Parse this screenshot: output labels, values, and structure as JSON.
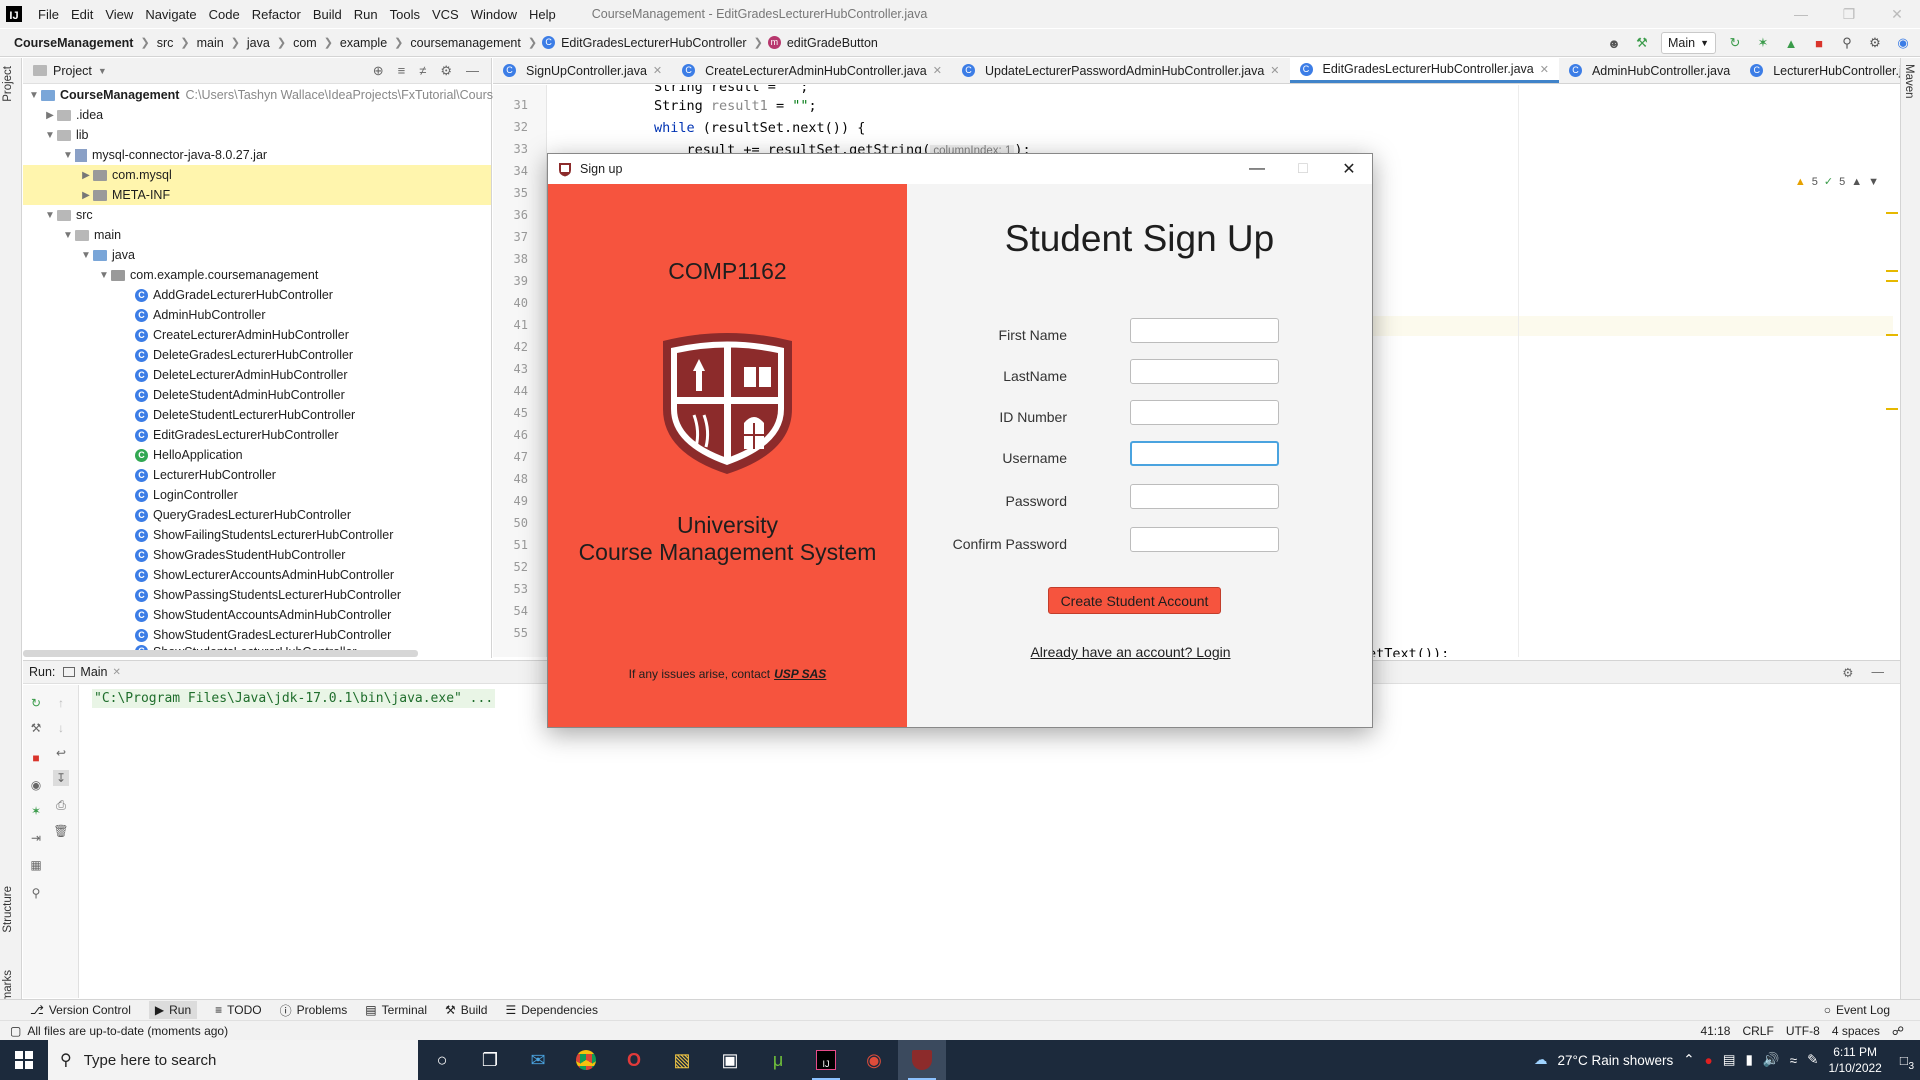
{
  "ide": {
    "window_title": "CourseManagement - EditGradesLecturerHubController.java",
    "menu": [
      "File",
      "Edit",
      "View",
      "Navigate",
      "Code",
      "Refactor",
      "Build",
      "Run",
      "Tools",
      "VCS",
      "Window",
      "Help"
    ],
    "breadcrumbs": [
      "CourseManagement",
      "src",
      "main",
      "java",
      "com",
      "example",
      "coursemanagement",
      "EditGradesLecturerHubController",
      "editGradeButton"
    ],
    "run_config": "Main"
  },
  "project": {
    "header": "Project",
    "tree": [
      {
        "label": "CourseManagement",
        "path": "C:\\Users\\Tashyn Wallace\\IdeaProjects\\FxTutorial\\CourseMa"
      },
      {
        "label": ".idea"
      },
      {
        "label": "lib"
      },
      {
        "label": "mysql-connector-java-8.0.27.jar"
      },
      {
        "label": "com.mysql"
      },
      {
        "label": "META-INF"
      },
      {
        "label": "src"
      },
      {
        "label": "main"
      },
      {
        "label": "java"
      },
      {
        "label": "com.example.coursemanagement"
      },
      {
        "label": "AddGradeLecturerHubController"
      },
      {
        "label": "AdminHubController"
      },
      {
        "label": "CreateLecturerAdminHubController"
      },
      {
        "label": "DeleteGradesLecturerHubController"
      },
      {
        "label": "DeleteLecturerAdminHubController"
      },
      {
        "label": "DeleteStudentAdminHubController"
      },
      {
        "label": "DeleteStudentLecturerHubController"
      },
      {
        "label": "EditGradesLecturerHubController"
      },
      {
        "label": "HelloApplication"
      },
      {
        "label": "LecturerHubController"
      },
      {
        "label": "LoginController"
      },
      {
        "label": "QueryGradesLecturerHubController"
      },
      {
        "label": "ShowFailingStudentsLecturerHubController"
      },
      {
        "label": "ShowGradesStudentHubController"
      },
      {
        "label": "ShowLecturerAccountsAdminHubController"
      },
      {
        "label": "ShowPassingStudentsLecturerHubController"
      },
      {
        "label": "ShowStudentAccountsAdminHubController"
      },
      {
        "label": "ShowStudentGradesLecturerHubController"
      },
      {
        "label": "ShowStudentsLecturerHubController"
      }
    ]
  },
  "editor": {
    "tabs": [
      "SignUpController.java",
      "CreateLecturerAdminHubController.java",
      "UpdateLecturerPasswordAdminHubController.java",
      "EditGradesLecturerHubController.java",
      "AdminHubController.java",
      "LecturerHubController.java"
    ],
    "line_numbers": [
      "31",
      "32",
      "33",
      "34",
      "35",
      "36",
      "37",
      "38",
      "39",
      "40",
      "41",
      "42",
      "43",
      "44",
      "45",
      "46",
      "47",
      "48",
      "49",
      "50",
      "51",
      "52",
      "53",
      "54",
      "55"
    ],
    "code": {
      "l30": "String result = \"\";",
      "l31a": "String ",
      "l31b": "result1",
      "l31c": " = ",
      "l31d": "\"\"",
      "l31e": ";",
      "l32a": "while",
      "l32b": " (resultSet.next()) {",
      "l33a": "    result += resultSet.getString(",
      "l33hint": "columnIndex: 1",
      "l33b": ");",
      "l56": "etText());"
    },
    "inspection_warnings": "5",
    "inspection_ok": "5"
  },
  "run_panel": {
    "label": "Run:",
    "tab": "Main",
    "console_line": "\"C:\\Program Files\\Java\\jdk-17.0.1\\bin\\java.exe\" ..."
  },
  "bottom_tools": [
    "Version Control",
    "Run",
    "TODO",
    "Problems",
    "Terminal",
    "Build",
    "Dependencies"
  ],
  "event_log": "Event Log",
  "status": {
    "message": "All files are up-to-date (moments ago)",
    "position": "41:18",
    "line_sep": "CRLF",
    "encoding": "UTF-8",
    "indent": "4 spaces"
  },
  "left_stripe": {
    "project": "Project",
    "structure": "Structure",
    "bookmarks": "Bookmarks"
  },
  "right_stripe": {
    "maven": "Maven"
  },
  "taskbar": {
    "search_placeholder": "Type here to search",
    "weather": "27°C  Rain showers",
    "time": "6:11 PM",
    "date": "1/10/2022",
    "notifications": "3"
  },
  "dialog": {
    "title": "Sign up",
    "course_code": "COMP1162",
    "uni_line1": "University",
    "uni_line2": "Course Management System",
    "contact_text": "If any issues arise, contact",
    "contact_link": "USP SAS",
    "form_title": "Student Sign Up",
    "fields": [
      {
        "label": "First Name",
        "value": ""
      },
      {
        "label": "LastName",
        "value": ""
      },
      {
        "label": "ID Number",
        "value": ""
      },
      {
        "label": "Username",
        "value": ""
      },
      {
        "label": "Password",
        "value": ""
      },
      {
        "label": "Confirm Password",
        "value": ""
      }
    ],
    "create_button": "Create Student Account",
    "login_link": "Already have an account? Login",
    "accent_color": "#f6543e",
    "crest_color": "#8c2b2b"
  }
}
